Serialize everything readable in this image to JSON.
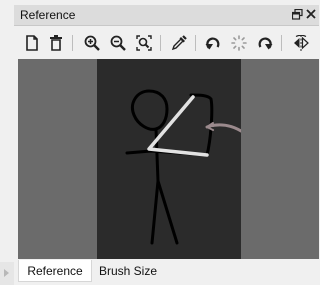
{
  "panel": {
    "title": "Reference",
    "float_symbol": "🗗",
    "close_symbol": "✕"
  },
  "toolbar": {
    "buttons": [
      {
        "name": "new-document-icon"
      },
      {
        "name": "trash-icon"
      },
      {
        "name": "zoom-in-icon"
      },
      {
        "name": "zoom-out-icon"
      },
      {
        "name": "zoom-fit-icon"
      },
      {
        "name": "eyedropper-icon"
      },
      {
        "name": "rotate-left-icon"
      },
      {
        "name": "loading-spinner-icon"
      },
      {
        "name": "rotate-right-icon"
      },
      {
        "name": "flip-horizontal-icon"
      }
    ]
  },
  "tabs": [
    {
      "label": "Reference",
      "active": true
    },
    {
      "label": "Brush Size",
      "active": false
    }
  ]
}
